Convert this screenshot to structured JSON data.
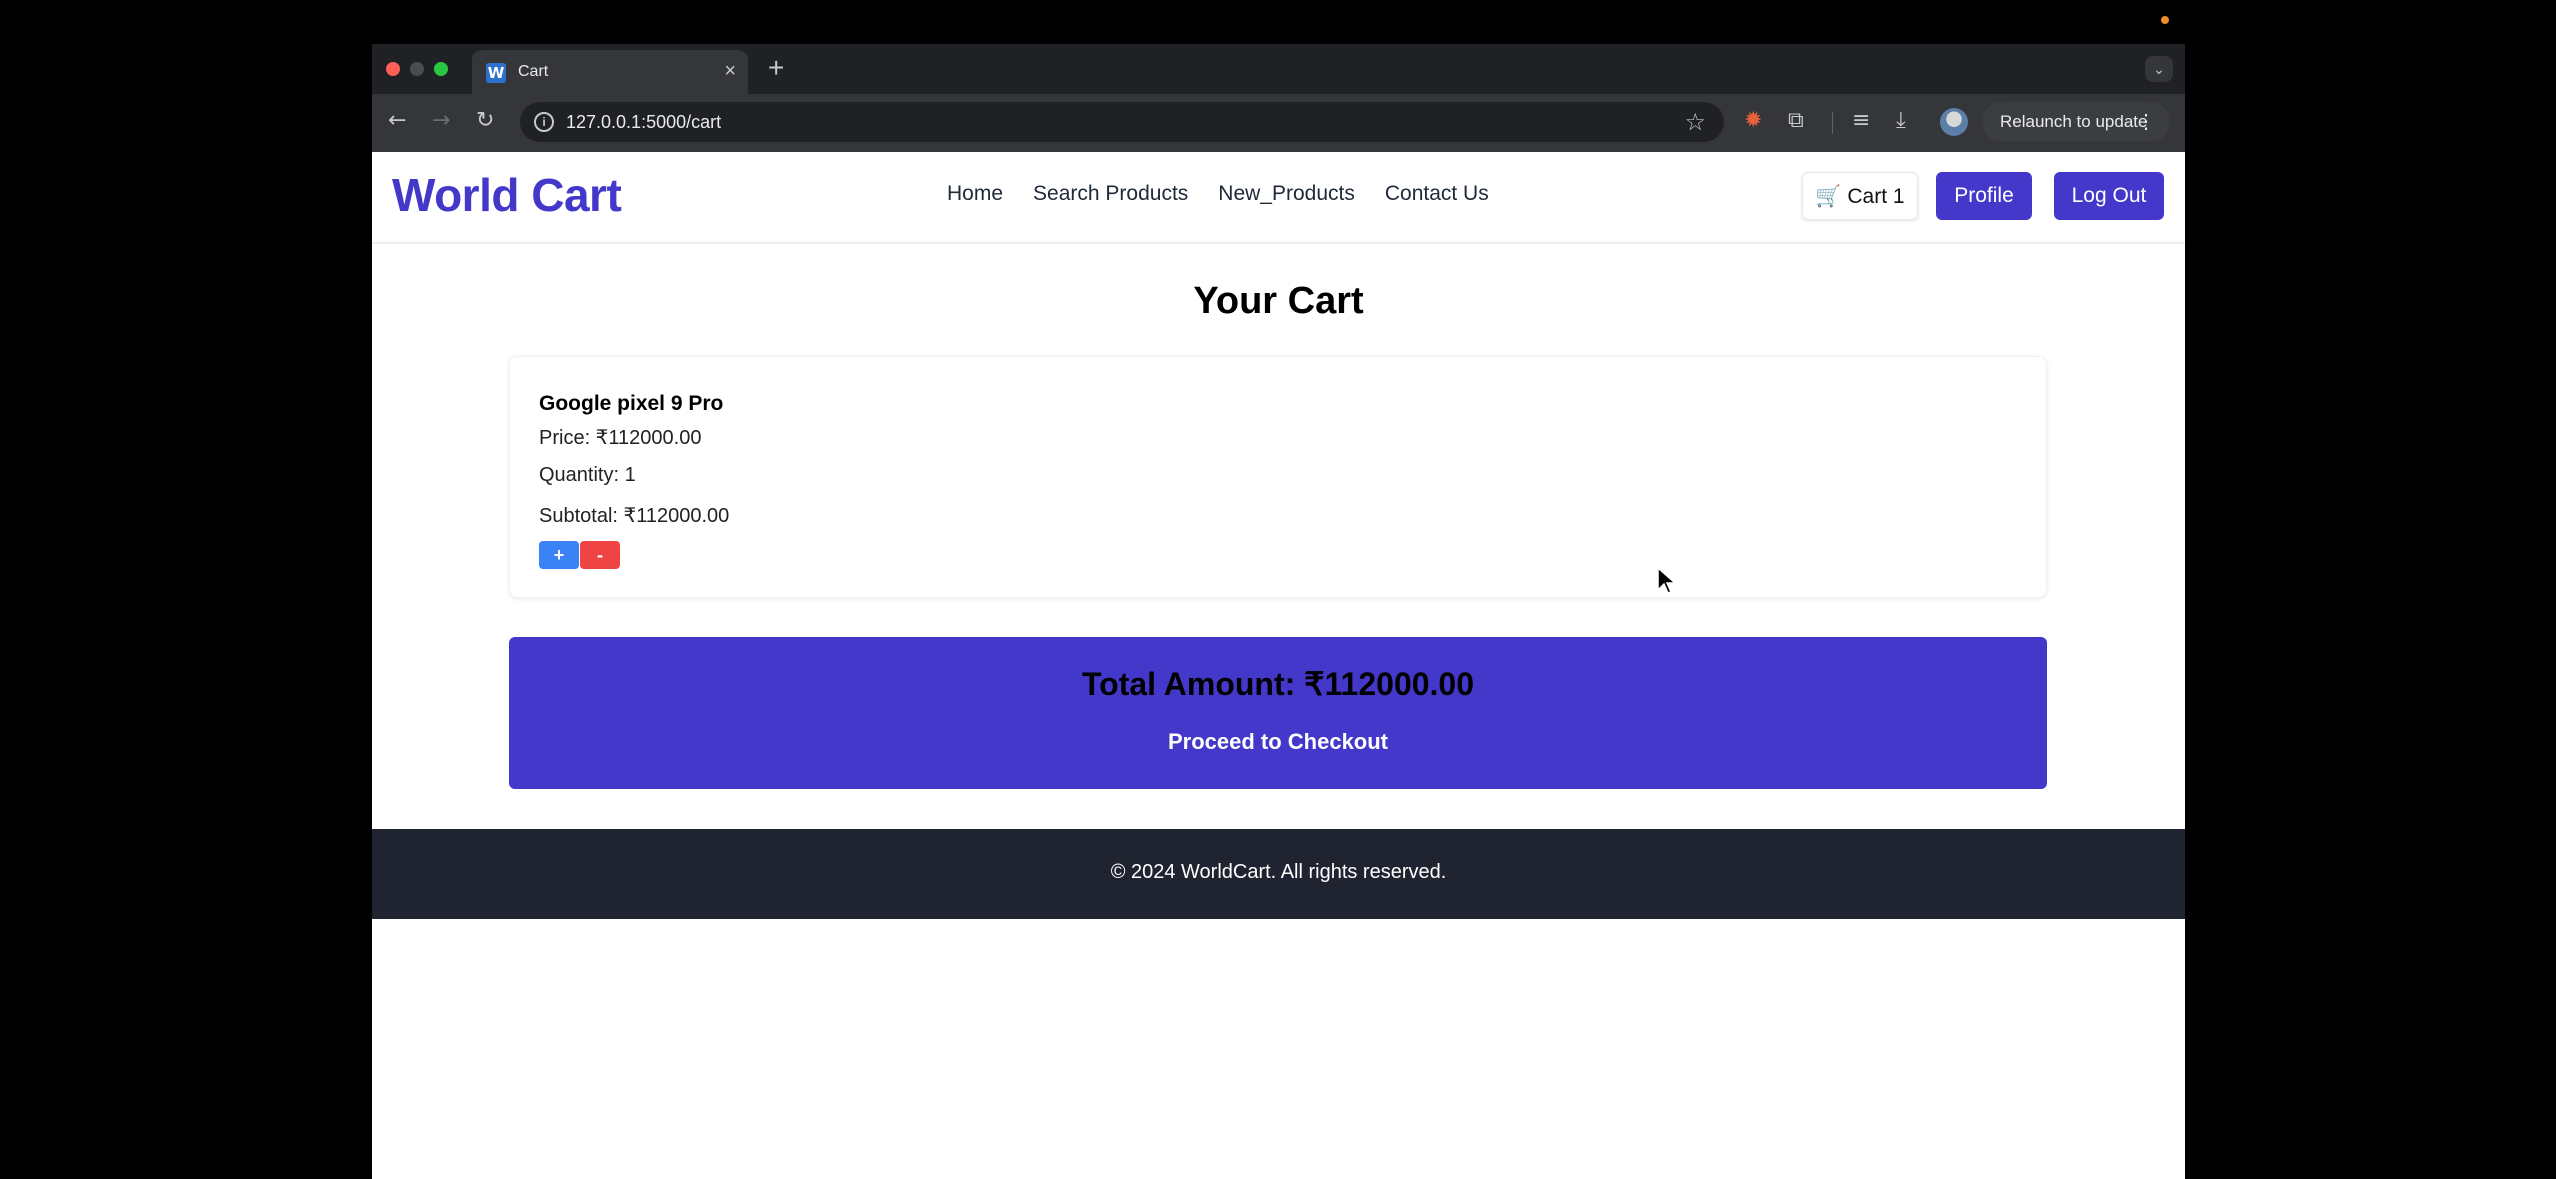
{
  "browser": {
    "tab_title": "Cart",
    "tab_favicon": "W",
    "url": "127.0.0.1:5000/cart",
    "relaunch_label": "Relaunch to update",
    "icons": [
      "back-arrow-icon",
      "forward-arrow-icon",
      "reload-icon",
      "site-info-icon",
      "bookmark-star-icon",
      "extension-bug-icon",
      "extensions-puzzle-icon",
      "media-queue-icon",
      "download-icon",
      "profile-avatar",
      "more-menu-icon",
      "tab-search-icon",
      "new-tab-icon",
      "close-tab-icon"
    ]
  },
  "header": {
    "logo": "World Cart",
    "nav": [
      "Home",
      "Search Products",
      "New_Products",
      "Contact Us"
    ],
    "cart_label": "🛒 Cart 1",
    "profile_label": "Profile",
    "logout_label": "Log Out"
  },
  "main": {
    "heading": "Your Cart",
    "item": {
      "name": "Google pixel 9 Pro",
      "price": "Price: ₹112000.00",
      "quantity": "Quantity: 1",
      "subtotal": "Subtotal: ₹112000.00",
      "plus_label": "+",
      "minus_label": "-"
    },
    "total": "Total Amount: ₹112000.00",
    "checkout_label": "Proceed to Checkout"
  },
  "footer": {
    "text": "© 2024 WorldCart. All rights reserved."
  },
  "colors": {
    "brand": "#4338ca",
    "plus": "#3b82f6",
    "minus": "#ef4444",
    "footer_bg": "#1f2430"
  }
}
